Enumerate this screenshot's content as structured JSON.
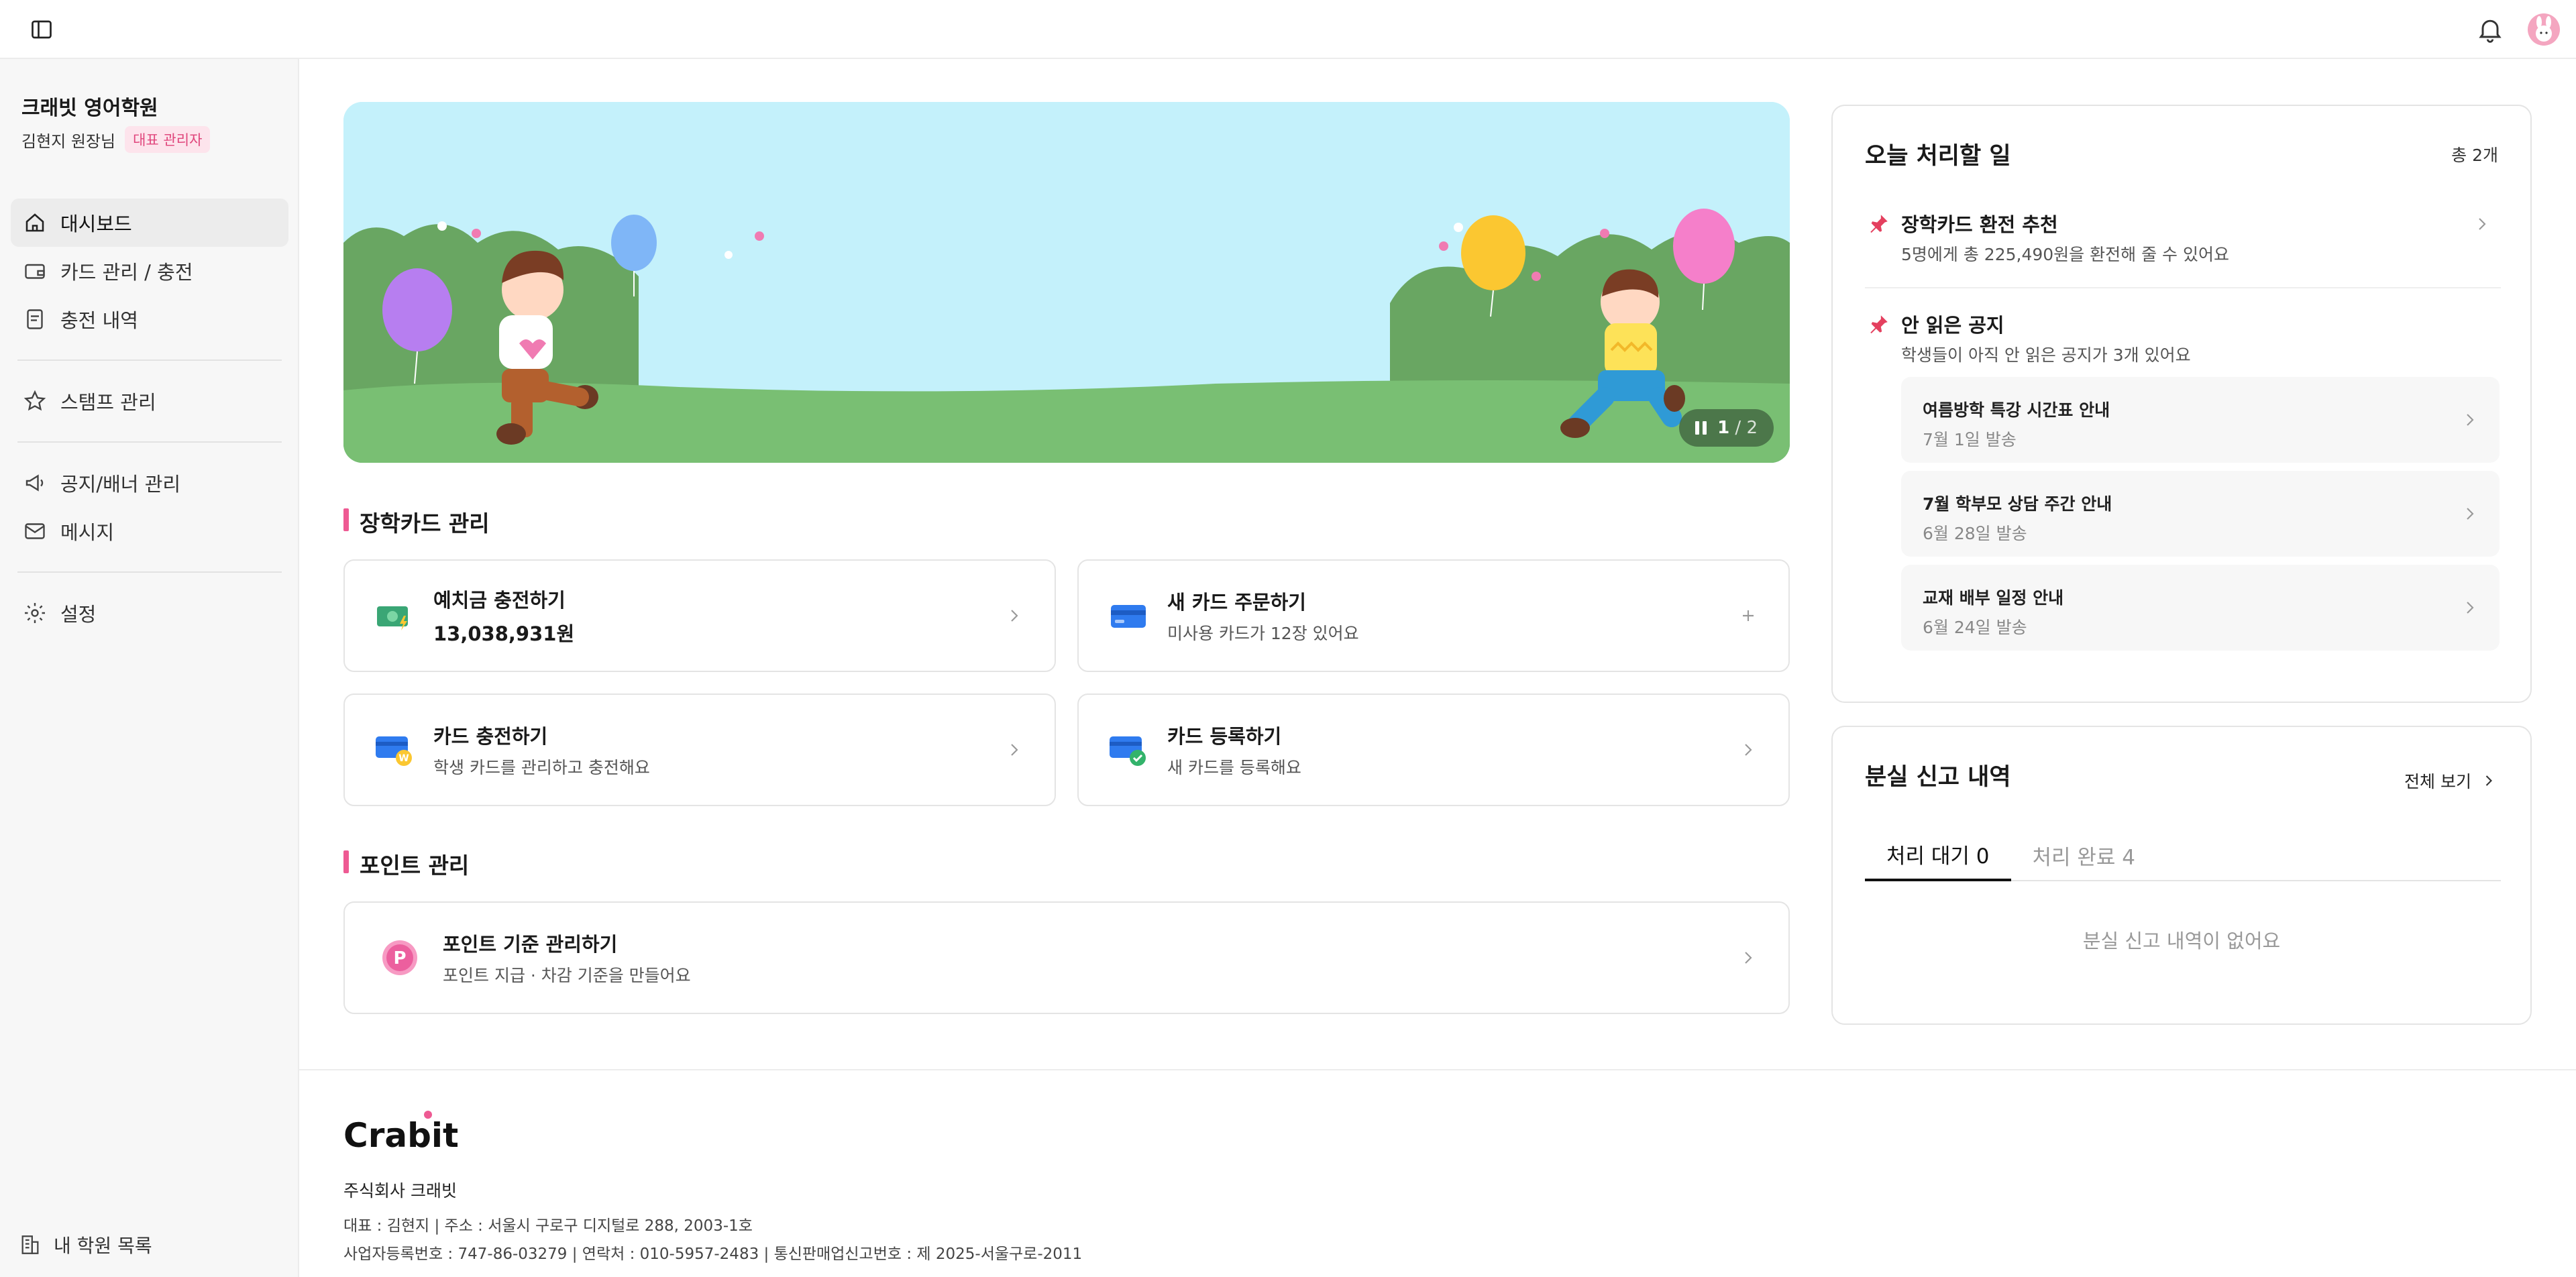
{
  "sidebar": {
    "academy_name": "크래빗 영어학원",
    "owner_name": "김현지 원장님",
    "role_badge": "대표 관리자",
    "nav": [
      {
        "label": "대시보드",
        "icon": "home-icon",
        "active": true
      },
      {
        "label": "카드 관리 / 충전",
        "icon": "wallet-icon"
      },
      {
        "label": "충전 내역",
        "icon": "receipt-icon"
      },
      {
        "label": "스탬프 관리",
        "icon": "star-icon"
      },
      {
        "label": "공지/배너 관리",
        "icon": "megaphone-icon"
      },
      {
        "label": "메시지",
        "icon": "mail-icon"
      },
      {
        "label": "설정",
        "icon": "gear-icon"
      }
    ],
    "bottom_link": "내 학원 목록"
  },
  "banner": {
    "current": "1",
    "total": "/ 2"
  },
  "scholarship": {
    "section_title": "장학카드 관리",
    "cards": [
      {
        "title": "예치금 충전하기",
        "sub": "13,038,931원"
      },
      {
        "title": "새 카드 주문하기",
        "sub": "미사용 카드가 12장 있어요"
      },
      {
        "title": "카드 충전하기",
        "sub": "학생 카드를 관리하고 충전해요"
      },
      {
        "title": "카드 등록하기",
        "sub": "새 카드를 등록해요"
      }
    ]
  },
  "points": {
    "section_title": "포인트 관리",
    "card": {
      "title": "포인트 기준 관리하기",
      "sub": "포인트 지급 · 차감 기준을 만들어요"
    }
  },
  "todo": {
    "title": "오늘 처리할 일",
    "count": "총 2개",
    "items": [
      {
        "title": "장학카드 환전 추천",
        "desc": "5명에게 총 225,490원을 환전해 줄 수 있어요"
      },
      {
        "title": "안 읽은 공지",
        "desc": "학생들이 아직 안 읽은 공지가 3개 있어요"
      }
    ],
    "notices": [
      {
        "title": "여름방학 특강 시간표 안내",
        "date": "7월 1일 발송"
      },
      {
        "title": "7월 학부모 상담 주간 안내",
        "date": "6월 28일 발송"
      },
      {
        "title": "교재 배부 일정 안내",
        "date": "6월 24일 발송"
      }
    ]
  },
  "lost": {
    "title": "분실 신고 내역",
    "see_all": "전체 보기",
    "tabs": [
      "처리 대기 0",
      "처리 완료 4"
    ],
    "empty": "분실 신고 내역이 없어요"
  },
  "footer": {
    "logo": "Crabit",
    "company": "주식회사 크래빗",
    "info1": "대표 : 김현지 | 주소 : 서울시 구로구 디지털로 288, 2003-1호",
    "info2": "사업자등록번호 : 747-86-03279 | 연락처 : 010-5957-2483 | 통신판매업신고번호 : 제 2025-서울구로-2011"
  },
  "colors": {
    "accent": "#ee5a93",
    "banner_sky": "#c4f1fb",
    "grass": "#79bf73"
  }
}
